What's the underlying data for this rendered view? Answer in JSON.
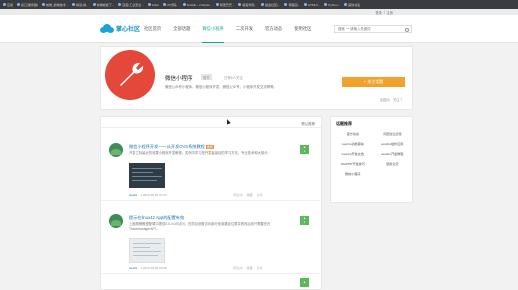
{
  "bookmarks": [
    {
      "label": "应用"
    },
    {
      "label": "窗口(服务器)"
    },
    {
      "label": "前端_前端技术..."
    },
    {
      "label": "精选-前..."
    },
    {
      "label": "前端模板下..."
    },
    {
      "label": "百度(工业安全..."
    },
    {
      "label": "Gitub"
    },
    {
      "label": "JS代码..."
    },
    {
      "label": "GitHub - vvfundo..."
    },
    {
      "label": "阿里巴巴..."
    },
    {
      "label": "极客学院..."
    },
    {
      "label": "掘金社区(..."
    },
    {
      "label": "博客园..."
    },
    {
      "label": "HTML5..."
    },
    {
      "label": "Python..."
    },
    {
      "label": "其他书签"
    }
  ],
  "topbar": {
    "login": "登录",
    "register": "注册"
  },
  "header": {
    "logo_text": "掌心社区",
    "nav": [
      "社区首页",
      "全部话题",
      "微信小程序",
      "二次开发",
      "官方动态",
      "使用社区"
    ],
    "active_nav_index": 2,
    "search_placeholder": "搜索 一 请输入关键词"
  },
  "banner": {
    "title": "微信小程序",
    "tag": "官方",
    "followers": "已有5人关注",
    "description": "微信公众号小程序、微信小程序开发、微信公众号、小程序开发交流等等。",
    "follow_label": "+ 关注话题",
    "meta": [
      "话题(5)",
      "关注 7"
    ]
  },
  "feed": {
    "sort_label": "默认推荐",
    "posts": [
      {
        "title": "微信小程序开发——从开发OVS系统教程",
        "badge": "推荐",
        "excerpt": "开发之际最近的效果小程序开发教程，实例中学习是开发者最佳的学习方法，专业技术和大部分...",
        "author": "weishi",
        "date": "1 2016-08-26 01:23",
        "votes": "1",
        "actions": [
          "评论(0)",
          "收藏",
          "分享"
        ]
      },
      {
        "title": "提示在linux42 App的配置有效",
        "badge": "",
        "excerpt": "上面按照教程配置中提供0.0.0.0/0访问，在项目设置访问部分找到路径位置并修改后你只需要在在TracemanagerAPI...",
        "author": "weishi",
        "date": "1 2016-08-26 02:55",
        "votes": "1",
        "actions": [
          "评论(0)",
          "收藏",
          "分享"
        ]
      }
    ]
  },
  "sidebar": {
    "title": "话题推荐",
    "topics": [
      "官方动态",
      "问题建议反馈",
      "weiphp功能模块",
      "weiphp插件应用",
      "weiphp开发文档",
      "weiphp开发教程",
      "WeiPHP开发技巧",
      "使用交流",
      "微信小程序"
    ]
  },
  "colors": {
    "accent": "#1aa394",
    "brand": "#1a8fc8",
    "follow": "#f0a22c",
    "app_icon": "#e3483b",
    "vote": "#5bb85b"
  }
}
